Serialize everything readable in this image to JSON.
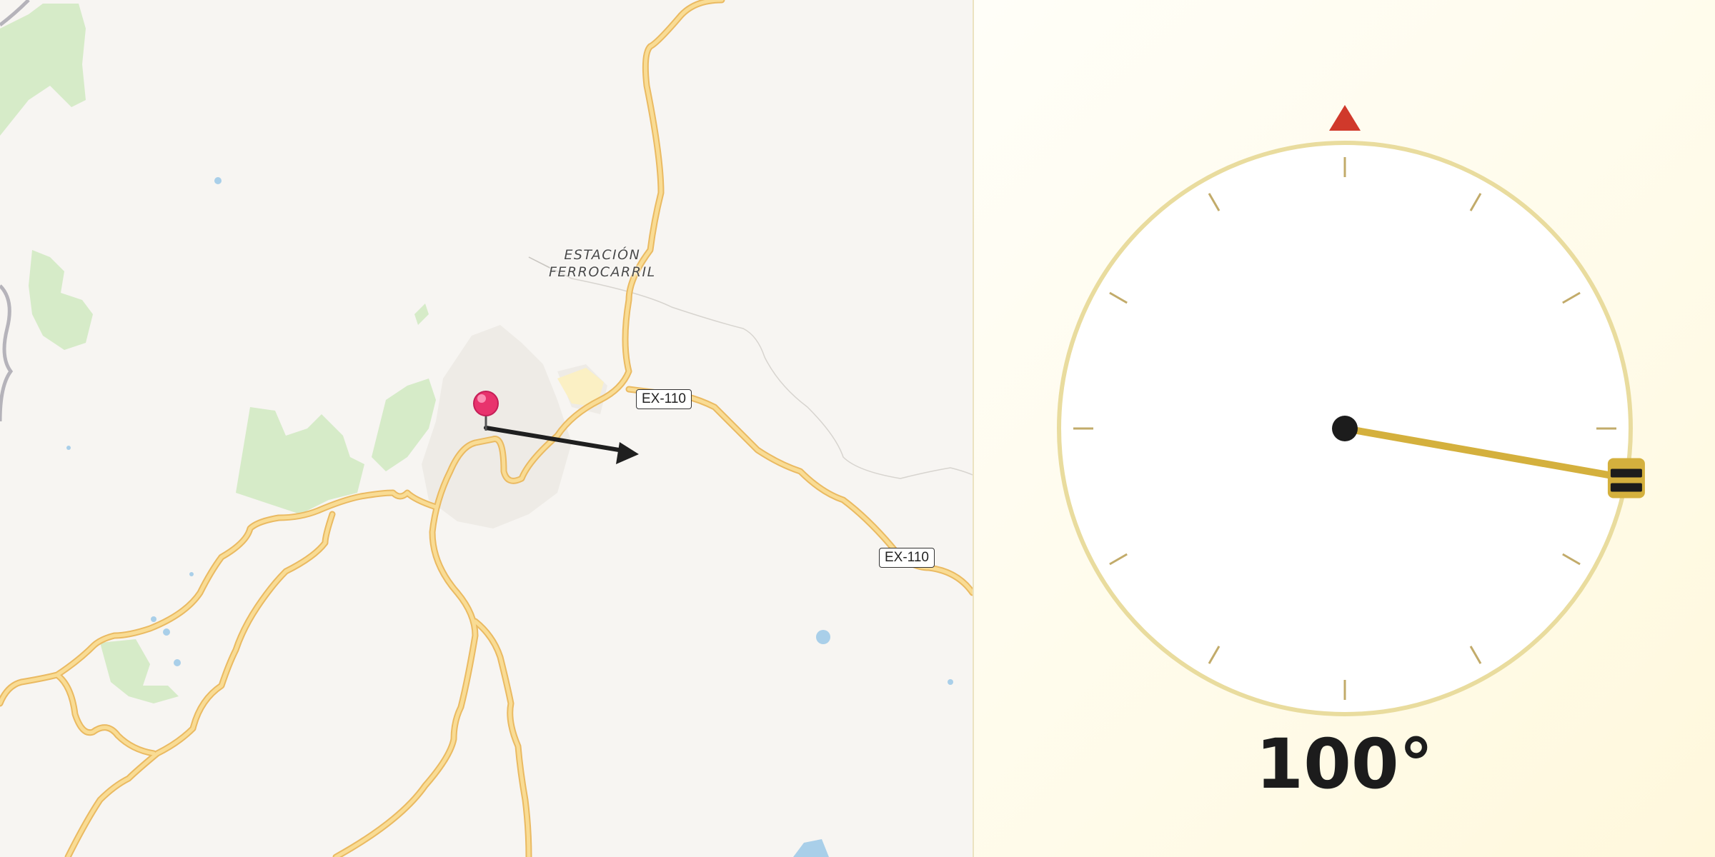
{
  "map": {
    "place_label_line1": "ESTACIÓN",
    "place_label_line2": "FERROCARRIL",
    "road_shields": [
      "EX-110",
      "EX-110"
    ],
    "pin_color": "#e8336d",
    "road_color": "#f6d27d",
    "park_color": "#d6ebc8",
    "water_color": "#a9cfe9"
  },
  "dial": {
    "angle_text": "100°",
    "bearing_degrees": 100,
    "north_marker_color": "#d0392b",
    "needle_color": "#d4b03d",
    "ring_color": "#e9dc9e"
  }
}
